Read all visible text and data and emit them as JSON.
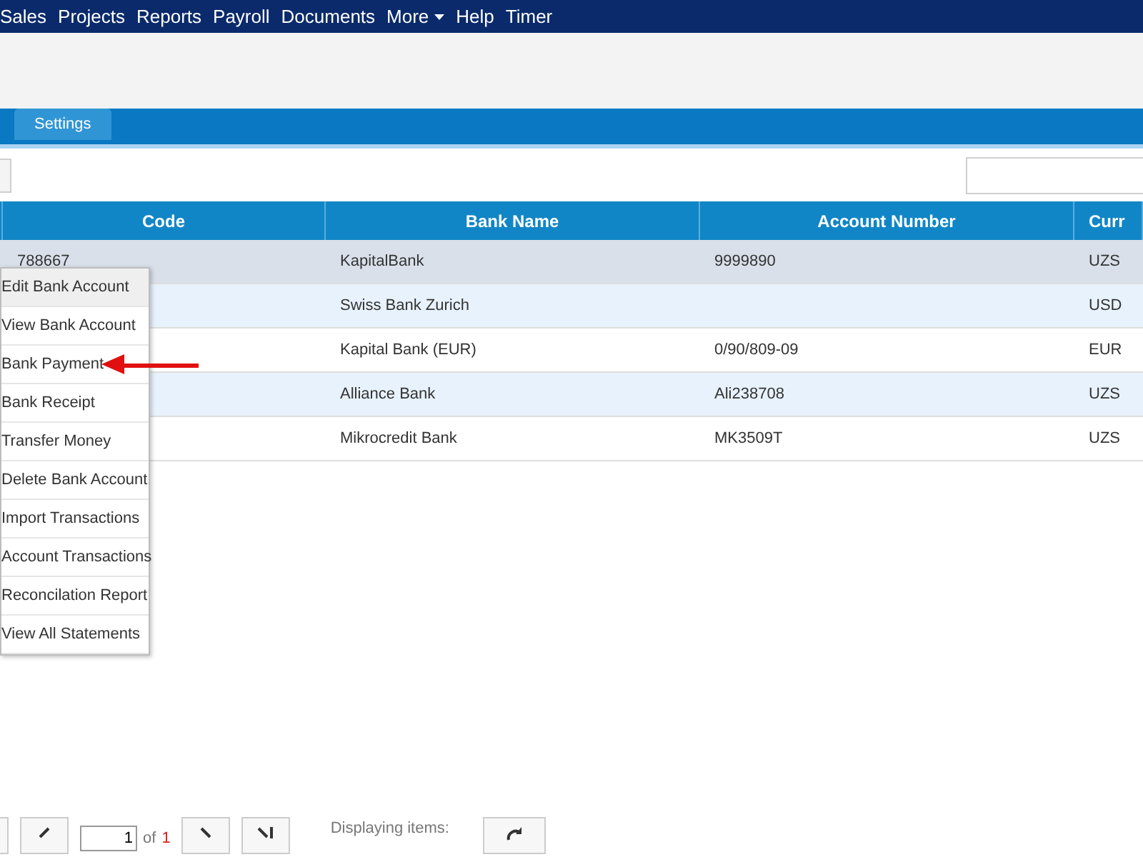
{
  "nav": {
    "items": [
      {
        "label": "Sales",
        "dropdown": false
      },
      {
        "label": "Projects",
        "dropdown": false
      },
      {
        "label": "Reports",
        "dropdown": false
      },
      {
        "label": "Payroll",
        "dropdown": false
      },
      {
        "label": "Documents",
        "dropdown": false
      },
      {
        "label": "More",
        "dropdown": true
      },
      {
        "label": "Help",
        "dropdown": false
      },
      {
        "label": "Timer",
        "dropdown": false
      }
    ]
  },
  "tabs": [
    {
      "label": "Settings",
      "selected": false
    }
  ],
  "table": {
    "columns": [
      "Code",
      "Bank Name",
      "Account Number",
      "Curr"
    ],
    "rows": [
      {
        "selected": true,
        "cells": [
          "788667",
          "KapitalBank",
          "9999890",
          "UZS"
        ]
      },
      {
        "selected": false,
        "cells": [
          "",
          "Swiss Bank Zurich",
          "",
          "USD"
        ]
      },
      {
        "selected": false,
        "cells": [
          "",
          "Kapital Bank (EUR)",
          "0/90/809-09",
          "EUR"
        ]
      },
      {
        "selected": false,
        "cells": [
          "",
          "Alliance Bank",
          "Ali238708",
          "UZS"
        ]
      },
      {
        "selected": false,
        "cells": [
          "",
          "Mikrocredit Bank",
          "MK3509T",
          "UZS"
        ]
      }
    ]
  },
  "context_menu": {
    "items": [
      {
        "label": "Edit Bank Account",
        "highlighted": true,
        "pointed": false
      },
      {
        "label": "View Bank Account",
        "highlighted": false,
        "pointed": false
      },
      {
        "label": "Bank Payment",
        "highlighted": false,
        "pointed": true
      },
      {
        "label": "Bank Receipt",
        "highlighted": false,
        "pointed": false
      },
      {
        "label": "Transfer Money",
        "highlighted": false,
        "pointed": false
      },
      {
        "label": "Delete Bank Account",
        "highlighted": false,
        "pointed": false
      },
      {
        "label": "Import Transactions",
        "highlighted": false,
        "pointed": false
      },
      {
        "label": "Account Transactions",
        "highlighted": false,
        "pointed": false
      },
      {
        "label": "Reconcilation Report",
        "highlighted": false,
        "pointed": false
      },
      {
        "label": "View All Statements",
        "highlighted": false,
        "pointed": false
      }
    ]
  },
  "pager": {
    "page": "1",
    "of": "of",
    "total": "1",
    "display": "Displaying items:"
  }
}
